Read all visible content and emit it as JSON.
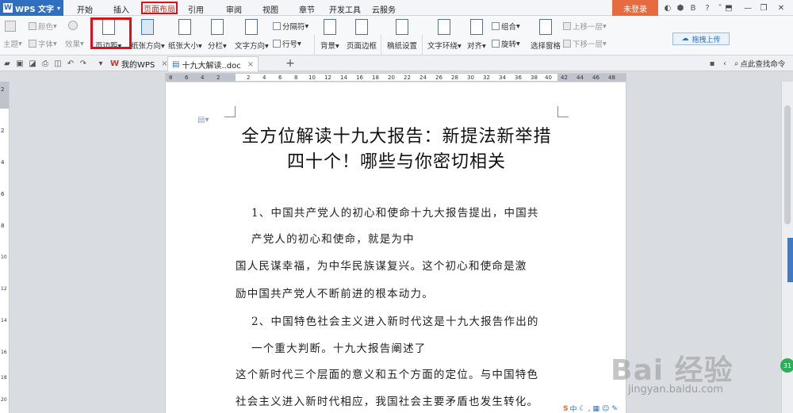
{
  "app": {
    "name": "WPS 文字"
  },
  "menu": {
    "tabs": [
      "开始",
      "插入",
      "页面布局",
      "引用",
      "审阅",
      "视图",
      "章节",
      "开发工具",
      "云服务"
    ],
    "active": "页面布局",
    "login": "未登录"
  },
  "ribbon": {
    "theme": "主题",
    "color": "颜色",
    "font": "字体",
    "effect": "效果",
    "margins": "页边距",
    "orientation": "纸张方向",
    "size": "纸张大小",
    "columns": "分栏",
    "text_direction": "文字方向",
    "breaks": "分隔符",
    "line_numbers": "行号",
    "background": "背景",
    "page_border": "页面边框",
    "paper_settings": "稿纸设置",
    "wrap_text": "文字环绕",
    "align": "对齐",
    "group": "组合",
    "rotate": "旋转",
    "selection_pane": "选择窗格",
    "bring_forward": "上移一层",
    "send_backward": "下移一层",
    "upload": "拖拽上传"
  },
  "tabs": {
    "home": "我的WPS",
    "document": "十九大解读..doc"
  },
  "find_command": "点此查找命令",
  "ruler": {
    "top_ticks": [
      "8",
      "6",
      "4",
      "2",
      "2",
      "4",
      "6",
      "8",
      "10",
      "12",
      "14",
      "16",
      "18",
      "20",
      "22",
      "24",
      "26",
      "28",
      "30",
      "32",
      "34",
      "36",
      "38",
      "40",
      "42",
      "44",
      "46",
      "48"
    ],
    "left_ticks": [
      "2",
      "2",
      "4",
      "6",
      "8",
      "10",
      "12",
      "14",
      "16",
      "18",
      "20"
    ]
  },
  "document": {
    "title_line1": "全方位解读十九大报告：新提法新举措",
    "title_line2": "四十个！哪些与你密切相关",
    "lines": [
      "1、中国共产党人的初心和使命十九大报告提出，中国共",
      "产党人的初心和使命，就是为中",
      "国人民谋幸福，为中华民族谋复兴。这个初心和使命是激",
      "励中国共产党人不断前进的根本动力。",
      "2、中国特色社会主义进入新时代这是十九大报告作出的",
      "一个重大判断。十九大报告阐述了",
      "这个新时代三个层面的意义和五个方面的定位。与中国特色",
      "社会主义进入新时代相应，我国社会主要矛盾也发生转化。"
    ]
  },
  "watermark": {
    "logo": "Bai 经验",
    "sub": "jingyan.baidu.com"
  },
  "badge": "31",
  "ime": "中"
}
